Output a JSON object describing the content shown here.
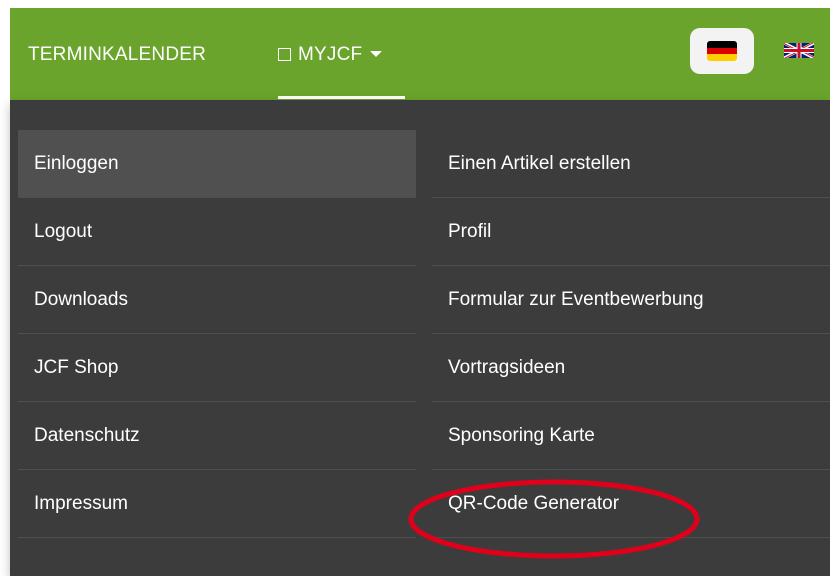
{
  "nav": {
    "items": [
      {
        "label": "TERMINKALENDER"
      },
      {
        "label": "MYJCF"
      }
    ]
  },
  "languages": [
    {
      "name": "Deutsch",
      "icon": "flag-de-icon",
      "selected": true
    },
    {
      "name": "English",
      "icon": "flag-uk-icon",
      "selected": false
    }
  ],
  "dropdown": {
    "left_items": [
      {
        "label": "Einloggen",
        "active": true
      },
      {
        "label": "Logout"
      },
      {
        "label": "Downloads"
      },
      {
        "label": "JCF Shop"
      },
      {
        "label": "Datenschutz"
      },
      {
        "label": "Impressum"
      }
    ],
    "right_items": [
      {
        "label": "Einen Artikel erstellen"
      },
      {
        "label": "Profil"
      },
      {
        "label": "Formular zur Eventbewerbung"
      },
      {
        "label": "Vortragsideen"
      },
      {
        "label": "Sponsoring Karte"
      },
      {
        "label": "QR-Code Generator",
        "highlighted": true
      }
    ]
  },
  "colors": {
    "topbar": "#6aa42c",
    "menu_background": "#3c3c3c",
    "active_item": "#505050",
    "highlight_ring": "#e0001b"
  }
}
